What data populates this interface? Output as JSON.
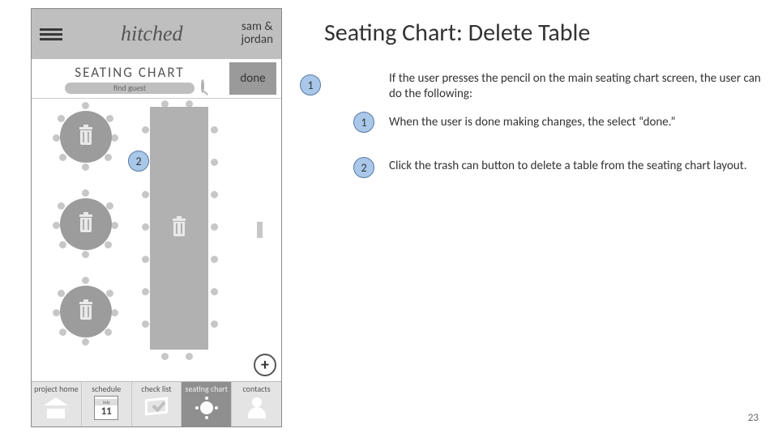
{
  "slide": {
    "title": "Seating Chart: Delete Table",
    "page_number": "23",
    "intro": "If the user presses the pencil on the main seating chart screen, the user can do the following:",
    "steps": [
      {
        "num": "1",
        "text": "When the user is done making changes, the select “done.”"
      },
      {
        "num": "2",
        "text": "Click the trash can button to delete a table from the seating chart layout."
      }
    ],
    "marker_intro": "1",
    "marker_on_phone": "2"
  },
  "app": {
    "brand": "hitched",
    "couple_line1": "sam &",
    "couple_line2": "jordan",
    "subtitle": "SEATING CHART",
    "search_placeholder": "find guest",
    "done_label": "done",
    "add_label": "+",
    "calendar_month": "July",
    "calendar_day": "11",
    "nav": [
      {
        "label": "project home"
      },
      {
        "label": "schedule"
      },
      {
        "label": "check list"
      },
      {
        "label": "seating chart"
      },
      {
        "label": "contacts"
      }
    ]
  }
}
